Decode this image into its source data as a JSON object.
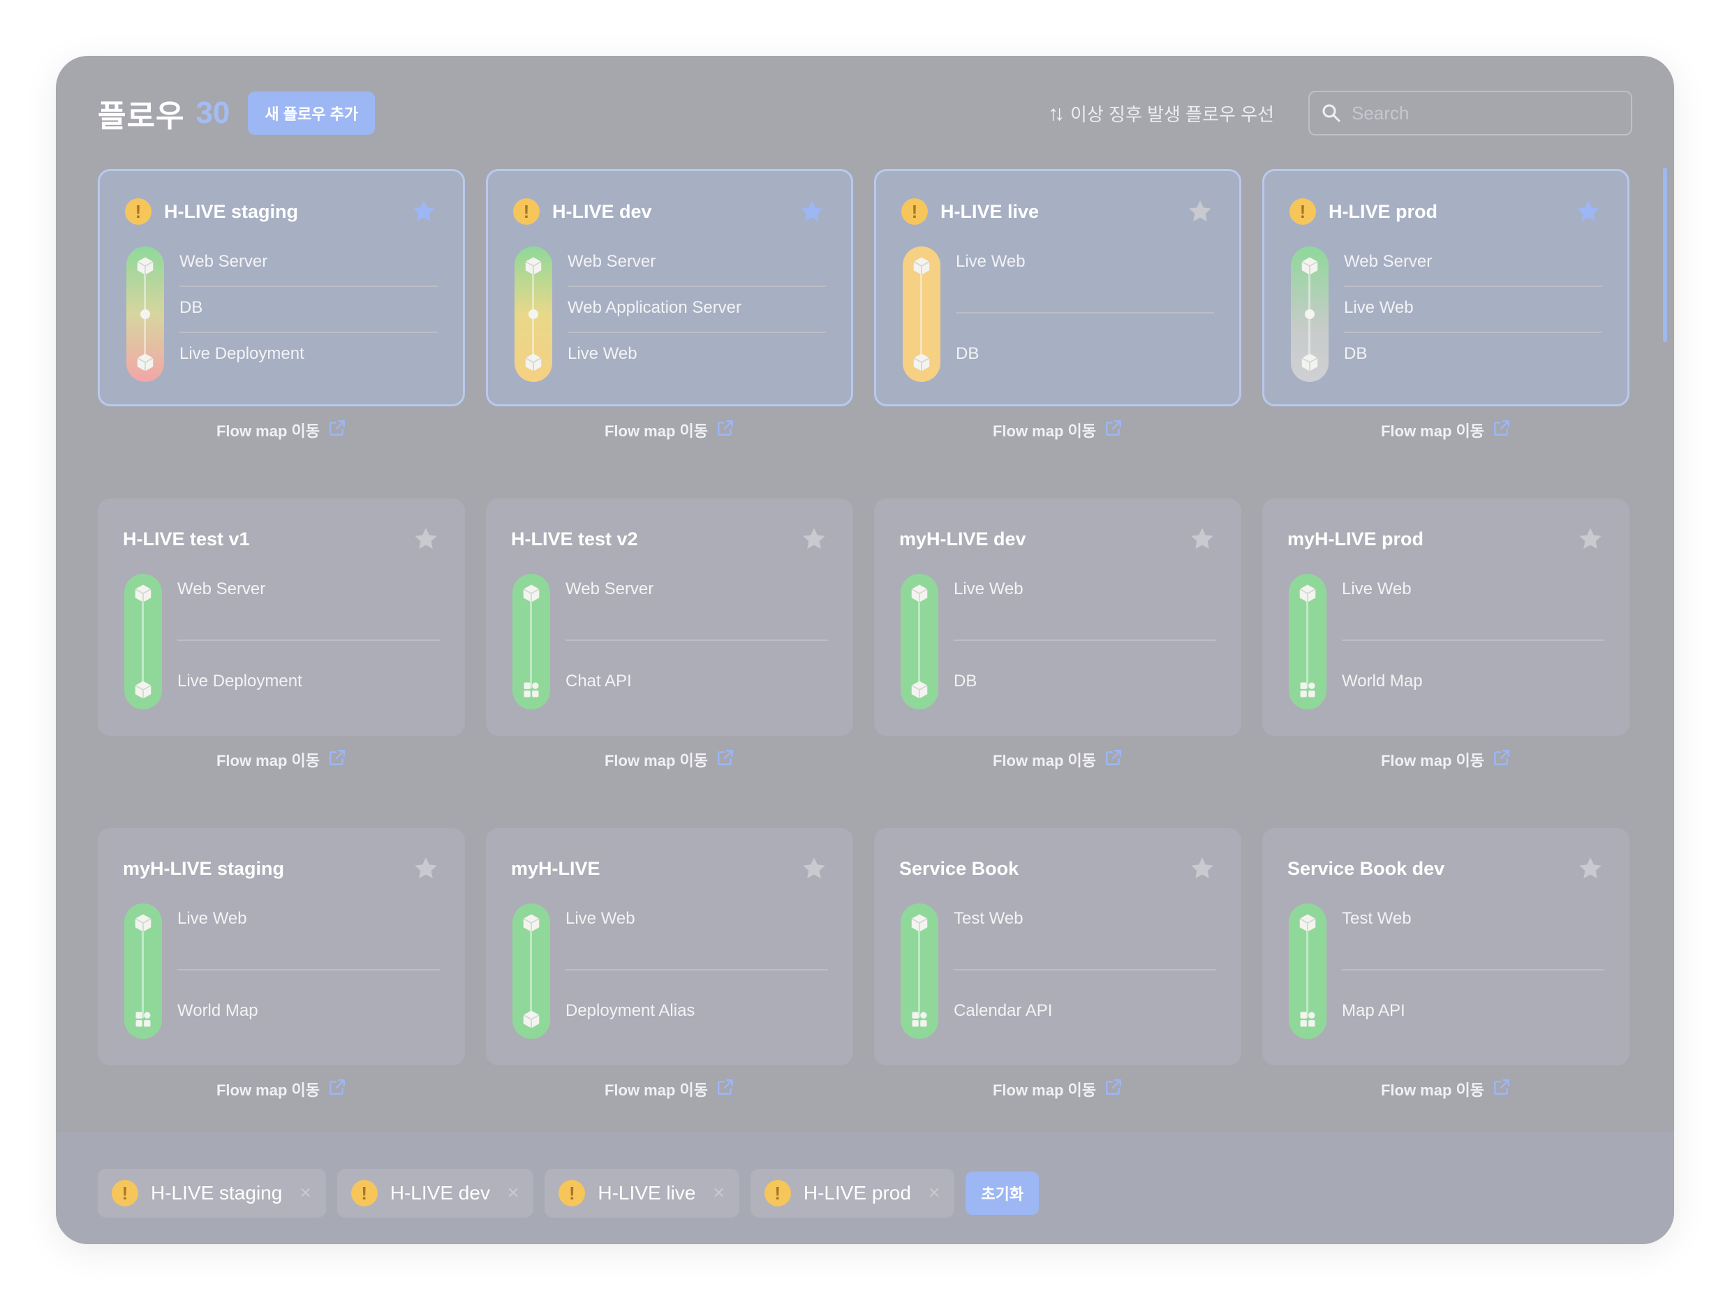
{
  "header": {
    "title": "플로우",
    "count": "30",
    "add_button": "새 플로우 추가",
    "sort_label": "이상 징후 발생 플로우 우선",
    "search_placeholder": "Search"
  },
  "flow_link_label": "Flow map 이동",
  "cards": [
    {
      "title": "H-LIVE staging",
      "warning": true,
      "starred": true,
      "items": [
        "Web Server",
        "DB",
        "Live Deployment"
      ]
    },
    {
      "title": "H-LIVE dev",
      "warning": true,
      "starred": true,
      "items": [
        "Web Server",
        "Web Application Server",
        "Live Web"
      ]
    },
    {
      "title": "H-LIVE live",
      "warning": true,
      "starred": false,
      "items": [
        "Live Web",
        "DB"
      ]
    },
    {
      "title": "H-LIVE prod",
      "warning": true,
      "starred": true,
      "items": [
        "Web Server",
        "Live Web",
        "DB"
      ]
    },
    {
      "title": "H-LIVE test v1",
      "warning": false,
      "starred": false,
      "items": [
        "Web Server",
        "Live Deployment"
      ]
    },
    {
      "title": "H-LIVE test v2",
      "warning": false,
      "starred": false,
      "items": [
        "Web Server",
        "Chat API"
      ]
    },
    {
      "title": "myH-LIVE dev",
      "warning": false,
      "starred": false,
      "items": [
        "Live Web",
        "DB"
      ]
    },
    {
      "title": "myH-LIVE prod",
      "warning": false,
      "starred": false,
      "items": [
        "Live Web",
        "World Map"
      ]
    },
    {
      "title": "myH-LIVE staging",
      "warning": false,
      "starred": false,
      "items": [
        "Live Web",
        "World Map"
      ]
    },
    {
      "title": "myH-LIVE",
      "warning": false,
      "starred": false,
      "items": [
        "Live Web",
        "Deployment Alias"
      ]
    },
    {
      "title": "Service Book",
      "warning": false,
      "starred": false,
      "items": [
        "Test Web",
        "Calendar API"
      ]
    },
    {
      "title": "Service Book dev",
      "warning": false,
      "starred": false,
      "items": [
        "Test Web",
        "Map API"
      ]
    }
  ],
  "filters": {
    "chips": [
      "H-LIVE staging",
      "H-LIVE dev",
      "H-LIVE live",
      "H-LIVE prod"
    ],
    "reset_button": "초기화"
  },
  "colors": {
    "accent": "#9db7f4",
    "warning": "#f6c65a",
    "ok": "#8fd89a",
    "error": "#f2a6a6",
    "neutral": "#c9cacf"
  }
}
